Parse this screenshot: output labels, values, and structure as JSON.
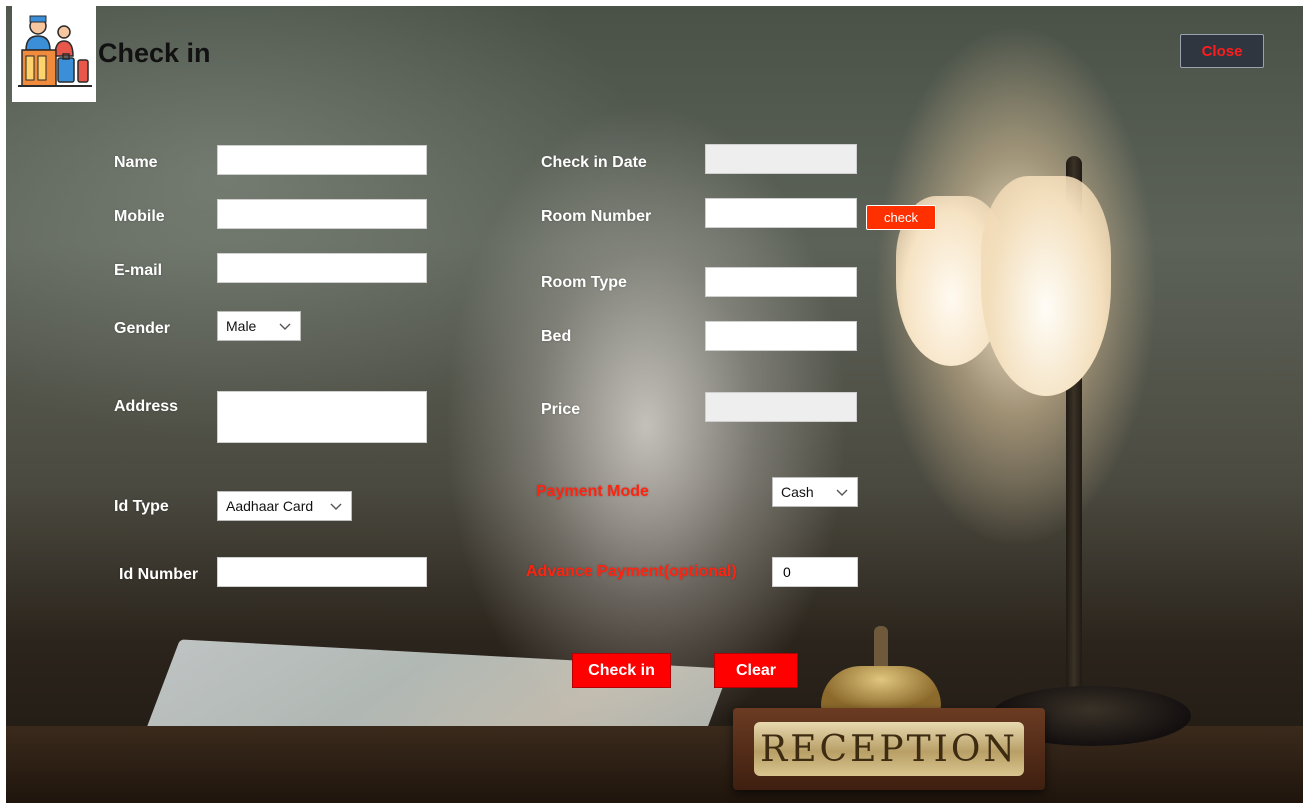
{
  "header": {
    "title": "Check in",
    "close_label": "Close",
    "logo_icon": "hotel-reception-icon"
  },
  "form": {
    "left": {
      "name_label": "Name",
      "mobile_label": "Mobile",
      "email_label": "E-mail",
      "gender_label": "Gender",
      "gender_value": "Male",
      "address_label": "Address",
      "id_type_label": "Id Type",
      "id_type_value": "Aadhaar Card",
      "id_number_label": "Id Number"
    },
    "right": {
      "checkin_date_label": "Check in Date",
      "room_number_label": "Room Number",
      "check_button": "check",
      "room_type_label": "Room Type",
      "bed_label": "Bed",
      "price_label": "Price",
      "payment_mode_label": "Payment Mode",
      "payment_mode_value": "Cash",
      "advance_payment_label": "Advance Payment(optional)",
      "advance_payment_value": "0"
    }
  },
  "actions": {
    "checkin_label": "Check in",
    "clear_label": "Clear"
  },
  "background": {
    "sign_text": "RECEPTION"
  },
  "colors": {
    "accent_red": "#ff0000",
    "check_orange": "#ff3000",
    "payment_label_red": "#ff2410",
    "close_text": "#ff1c1c"
  }
}
